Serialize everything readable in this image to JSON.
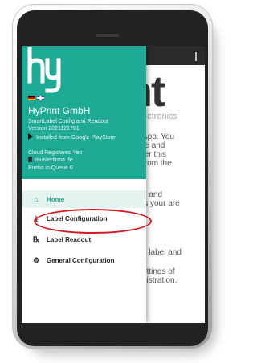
{
  "drawer": {
    "company": "HyPrint GmbH",
    "subtitle": "SmartLabel Config and Readout",
    "version": "Version 2021121701",
    "installed": "Installed from Google PlayStore",
    "cloud": "Cloud Registered Yes",
    "domain": "musterfirma.de",
    "queue": "Pushs in Queue 0",
    "items": [
      {
        "label": "Home",
        "icon": "home-icon"
      },
      {
        "label": "Label Configuration",
        "icon": "download-icon"
      },
      {
        "label": "Label Readout",
        "icon": "readout-icon"
      },
      {
        "label": "General Configuration",
        "icon": "settings-icon"
      }
    ]
  },
  "background": {
    "logo_text": "nt",
    "sub_text": "ectronics",
    "text_lines": [
      "App. You",
      "re and",
      "ter this",
      "from the",
      "e and",
      "ls your are",
      "a label and",
      "ettings of",
      "gistration."
    ]
  },
  "colors": {
    "accent": "#1faa96",
    "highlight": "#d11a22"
  }
}
